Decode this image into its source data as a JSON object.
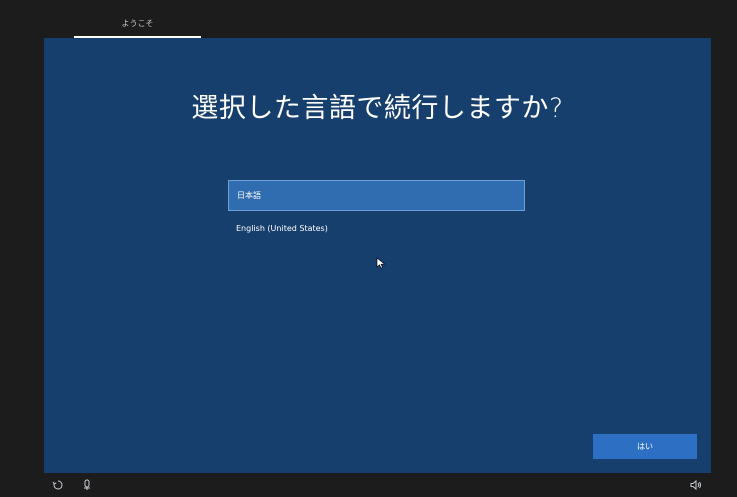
{
  "header": {
    "step_label": "ようこそ"
  },
  "main": {
    "title": "選択した言語で続行しますか?",
    "languages": [
      {
        "label": "日本語",
        "selected": true
      },
      {
        "label": "English (United States)",
        "selected": false
      }
    ],
    "yes_button": "はい"
  },
  "taskbar": {
    "icons": [
      "ease-of-access-icon",
      "microphone-icon",
      "volume-icon"
    ]
  },
  "colors": {
    "panel": "#163f6d",
    "selected": "#2f6cb0",
    "button": "#2d6fc2",
    "frame": "#1c1c1c"
  }
}
